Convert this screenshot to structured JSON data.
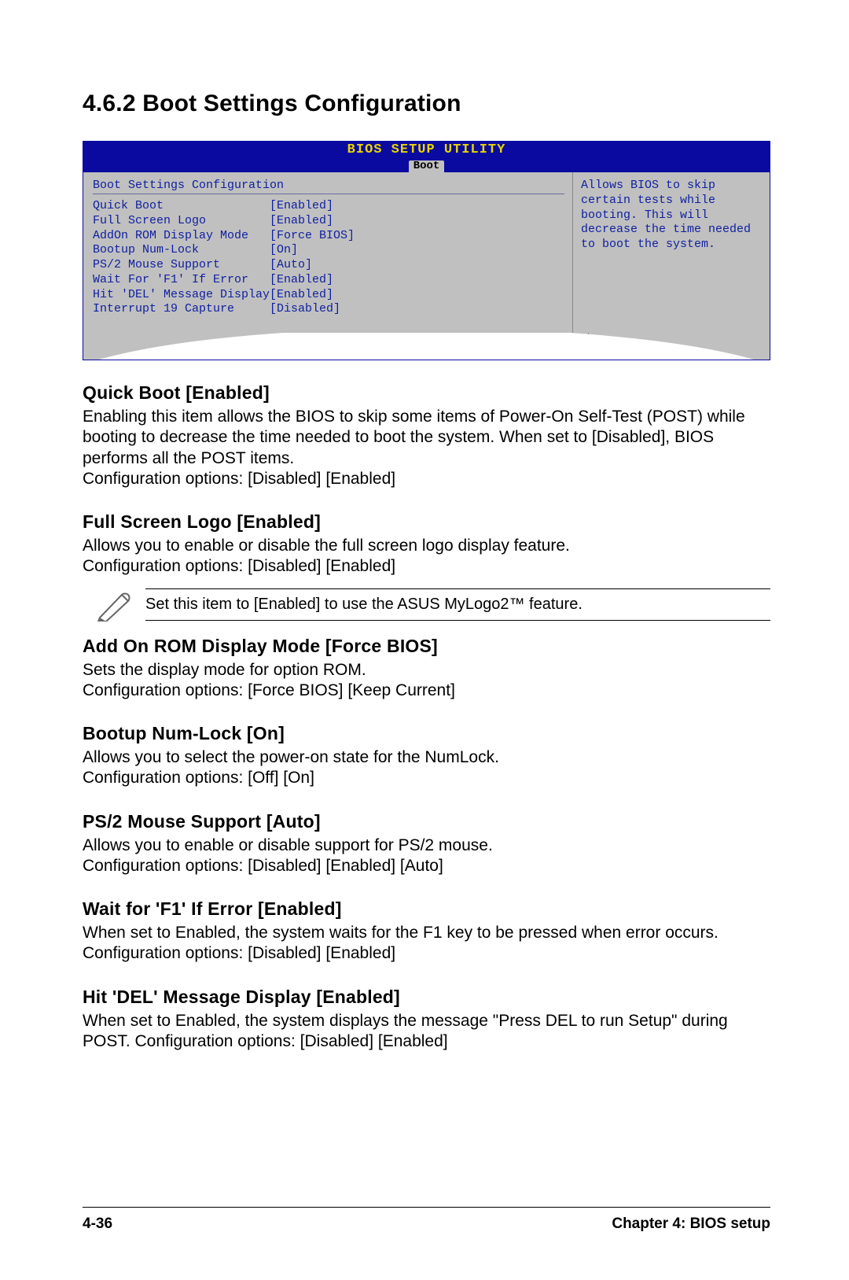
{
  "heading": "4.6.2  Boot Settings Configuration",
  "bios": {
    "title": "BIOS SETUP UTILITY",
    "tab": "Boot",
    "section_title": "Boot Settings Configuration",
    "rows": [
      {
        "label": "Quick Boot",
        "value": "[Enabled]"
      },
      {
        "label": "Full Screen Logo",
        "value": "[Enabled]"
      },
      {
        "label": "AddOn ROM Display Mode",
        "value": "[Force BIOS]"
      },
      {
        "label": "Bootup Num-Lock",
        "value": "[On]"
      },
      {
        "label": "PS/2 Mouse Support",
        "value": "[Auto]"
      },
      {
        "label": "Wait For 'F1' If Error",
        "value": "[Enabled]"
      },
      {
        "label": "Hit 'DEL' Message Display",
        "value": "[Enabled]"
      },
      {
        "label": "Interrupt 19 Capture",
        "value": "[Disabled]"
      }
    ],
    "help": "Allows BIOS to skip certain tests while booting. This will decrease the time needed to boot the system."
  },
  "sections": [
    {
      "title": "Quick Boot [Enabled]",
      "body": "Enabling this item allows the BIOS to skip some items of Power-On Self-Test (POST) while booting to decrease the time needed to boot the system. When set to [Disabled], BIOS performs all the POST items.\nConfiguration options: [Disabled] [Enabled]"
    },
    {
      "title": "Full Screen Logo [Enabled]",
      "body": "Allows you to enable or disable the full screen logo display feature.\nConfiguration options: [Disabled] [Enabled]"
    }
  ],
  "note": "Set this item to [Enabled] to use the ASUS MyLogo2™ feature.",
  "sections2": [
    {
      "title": "Add On ROM Display Mode [Force BIOS]",
      "body": "Sets the display mode for option ROM.\nConfiguration options: [Force BIOS] [Keep Current]"
    },
    {
      "title": "Bootup Num-Lock [On]",
      "body": "Allows you to select the power-on state for the NumLock.\nConfiguration options: [Off] [On]"
    },
    {
      "title": "PS/2 Mouse Support [Auto]",
      "body": "Allows you to enable or disable support for PS/2 mouse.\nConfiguration options: [Disabled] [Enabled] [Auto]"
    },
    {
      "title": "Wait for 'F1' If Error [Enabled]",
      "body": "When set to Enabled, the system waits for the F1 key to be pressed when error occurs. Configuration options: [Disabled] [Enabled]"
    },
    {
      "title": "Hit 'DEL' Message Display [Enabled]",
      "body": "When set to Enabled, the system displays the message \"Press DEL to run Setup\" during POST. Configuration options: [Disabled] [Enabled]"
    }
  ],
  "footer": {
    "left": "4-36",
    "right": "Chapter 4: BIOS setup"
  }
}
